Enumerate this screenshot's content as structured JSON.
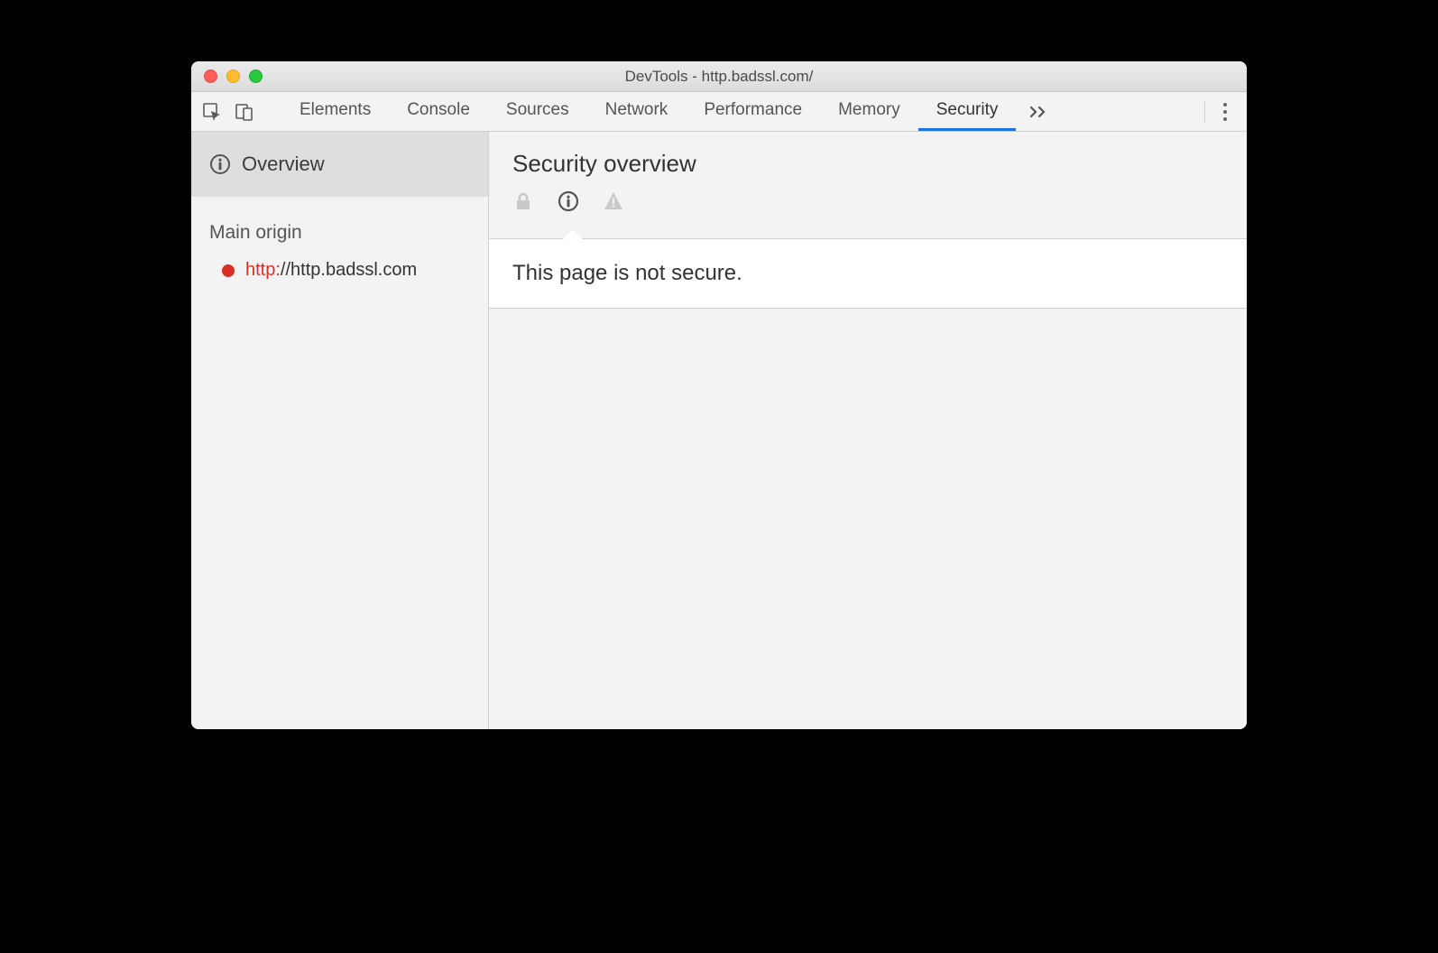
{
  "window": {
    "title": "DevTools - http.badssl.com/"
  },
  "tabs": {
    "items": [
      "Elements",
      "Console",
      "Sources",
      "Network",
      "Performance",
      "Memory",
      "Security"
    ],
    "active_index": 6
  },
  "sidebar": {
    "overview_label": "Overview",
    "section_heading": "Main origin",
    "origin": {
      "scheme": "http:",
      "rest": "//http.badssl.com",
      "status_color": "#d93025"
    }
  },
  "main": {
    "heading": "Security overview",
    "status_icons": [
      "lock",
      "info",
      "warning"
    ],
    "active_status_index": 1,
    "message": "This page is not secure."
  }
}
